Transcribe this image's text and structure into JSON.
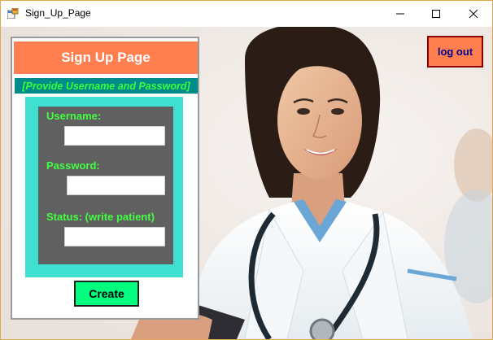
{
  "window": {
    "title": "Sign_Up_Page"
  },
  "header": {
    "title": "Sign Up Page",
    "subtitle": "[Provide Username and Password]"
  },
  "form": {
    "username_label": "Username:",
    "username_value": "",
    "password_label": "Password:",
    "password_value": "",
    "status_label": "Status: (write patient)",
    "status_value": ""
  },
  "buttons": {
    "create_label": "Create",
    "logout_label": "log out"
  },
  "colors": {
    "header_bg": "#ff7f50",
    "subheader_bg": "#008b8b",
    "subheader_text": "#39ff3a",
    "form_outer_bg": "#40e0d0",
    "form_inner_bg": "#606060",
    "label_text": "#41ff41",
    "create_bg": "#00ff7f",
    "logout_bg": "#ff7f50",
    "logout_text": "#00008b"
  },
  "icons": [
    "app-icon",
    "minimize-icon",
    "maximize-icon",
    "close-icon"
  ]
}
